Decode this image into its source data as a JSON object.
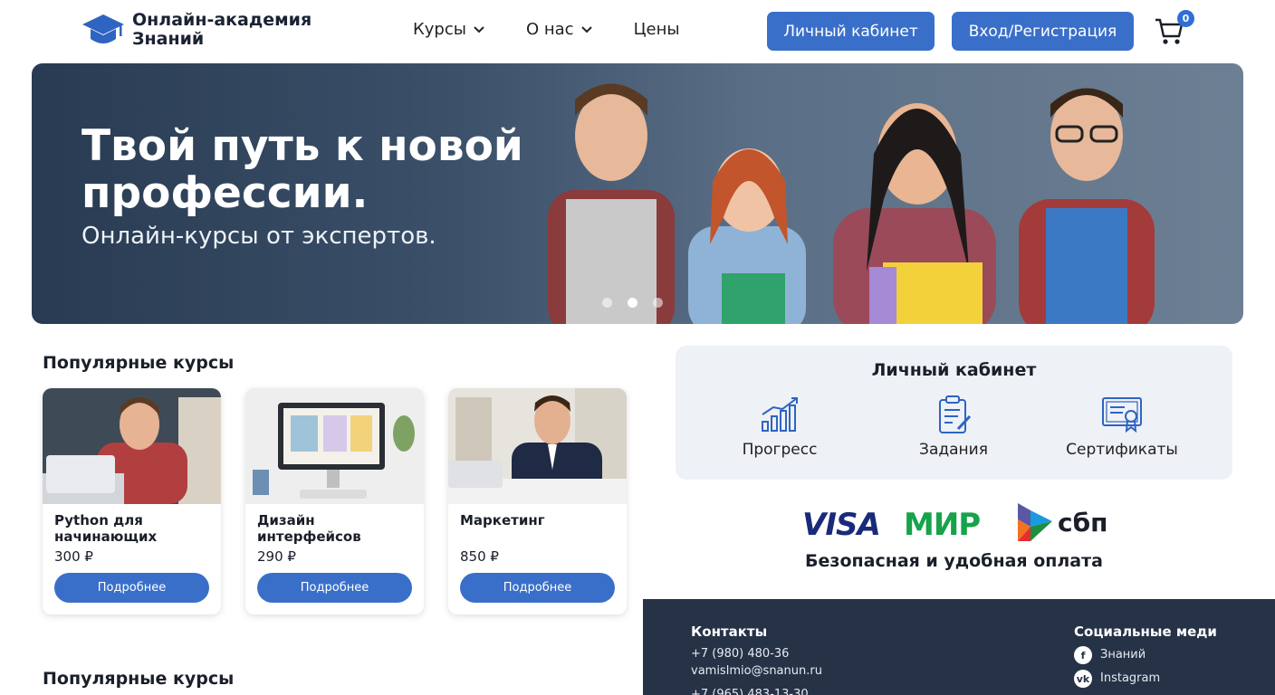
{
  "header": {
    "logo_line1": "Онлайн-академия",
    "logo_line2": "Знаний",
    "nav": [
      {
        "label": "Курсы",
        "has_dropdown": true
      },
      {
        "label": "О нас",
        "has_dropdown": true
      },
      {
        "label": "Цены",
        "has_dropdown": false
      }
    ],
    "cabinet_button": "Личный кабинет",
    "login_button": "Вход/Регистрация",
    "cart_count": "0",
    "cart_icon": "cart-icon"
  },
  "hero": {
    "title": "Твой путь к новой профессии.",
    "subtitle": "Онлайн-курсы от экспертов.",
    "slide_count": 3,
    "active_slide": 2
  },
  "popular": {
    "title": "Популярные курсы",
    "title_second": "Популярные курсы",
    "courses": [
      {
        "name": "Python для начинающих",
        "price": "300 ₽",
        "button": "Подробнее"
      },
      {
        "name": "Дизайн интерфейсов",
        "price": "290 ₽",
        "button": "Подробнее"
      },
      {
        "name": "Маркетинг",
        "price": "850 ₽",
        "button": "Подробнее"
      }
    ]
  },
  "cabinet_panel": {
    "title": "Личный кабинет",
    "items": [
      {
        "label": "Прогресс",
        "icon": "chart-icon"
      },
      {
        "label": "Задания",
        "icon": "clipboard-icon"
      },
      {
        "label": "Сертификаты",
        "icon": "certificate-icon"
      }
    ]
  },
  "payments": {
    "visa": "VISA",
    "mir": "МИР",
    "sbp": "сбп",
    "caption": "Безопасная и удобная оплата"
  },
  "footer": {
    "contacts_title": "Контакты",
    "phone1": "+7 (980) 480-36",
    "email": "vamislmio@snanun.ru",
    "phone2": "+7 (965) 483-13-30",
    "social_title": "Социальные меди",
    "social": [
      {
        "label": "Знаний",
        "icon": "facebook-icon"
      },
      {
        "label": "Instagram",
        "icon": "vk-icon"
      }
    ]
  },
  "colors": {
    "accent": "#3a6fc9",
    "footer_bg": "#263246",
    "panel_bg": "#eef1f6"
  }
}
